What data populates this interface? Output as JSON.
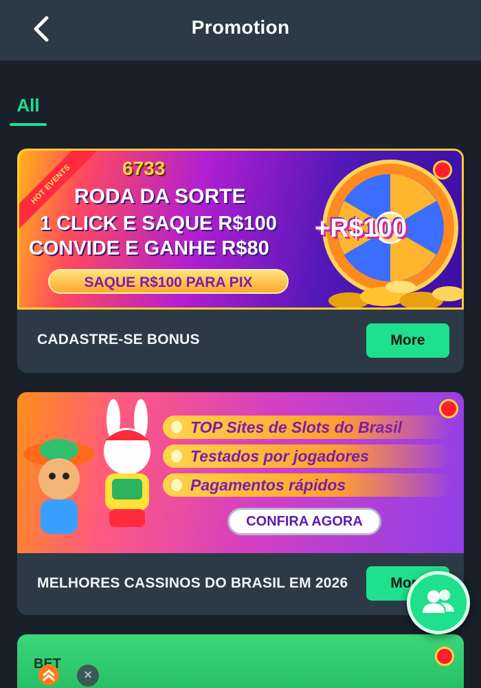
{
  "header": {
    "title": "Promotion",
    "back_icon": "chevron-left-icon"
  },
  "tabs": [
    {
      "label": "All",
      "active": true
    }
  ],
  "colors": {
    "accent": "#1fe08c",
    "header_bg": "#2c3a47",
    "page_bg": "#19202a",
    "card_bg": "#2c3a47"
  },
  "promotions": [
    {
      "title": "CADASTRE-SE BONUS",
      "more_label": "More",
      "banner": {
        "ribbon": "HOT EVENTS",
        "logo": "6733",
        "line1": "RODA DA SORTE",
        "line2": "1 CLICK E SAQUE R$100",
        "line3": "CONVIDE E GANHE R$80",
        "cta": "SAQUE R$100 PARA PIX",
        "bonus": "+R$100"
      }
    },
    {
      "title": "MELHORES CASSINOS DO BRASIL EM 2026",
      "more_label": "More",
      "banner": {
        "line1": "TOP Sites de Slots do Brasil",
        "line2": "Testados por jogadores",
        "line3": "Pagamentos rápidos",
        "cta": "CONFIRA AGORA"
      }
    },
    {
      "banner": {
        "logo": "BET"
      }
    }
  ],
  "floating": {
    "chat_icon": "users-icon",
    "scroll_up_icon": "double-chevron-up-icon",
    "close_icon": "close-icon"
  }
}
